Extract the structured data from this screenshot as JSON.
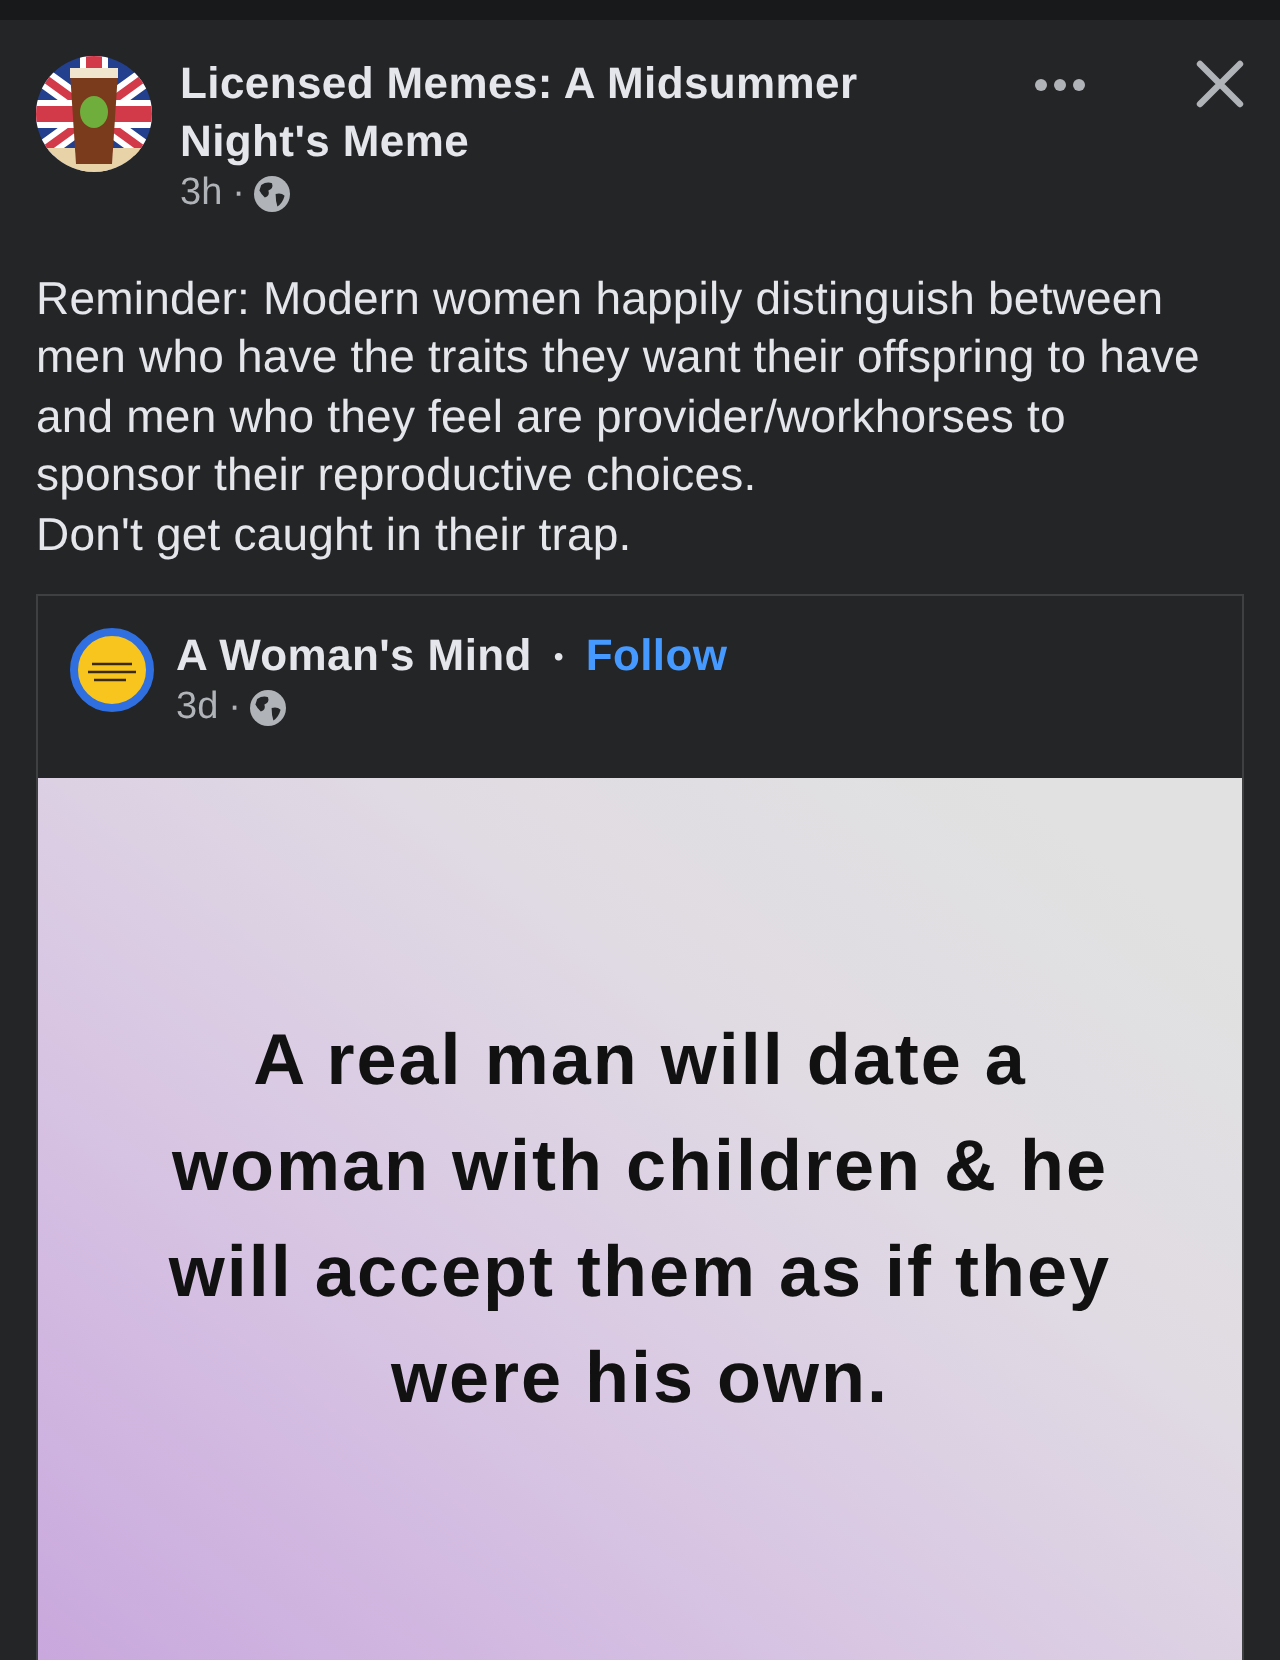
{
  "post": {
    "author": "Licensed Memes: A Midsummer Night's Meme",
    "time": "3h",
    "time_separator": "·",
    "text": [
      "Reminder: Modern women happily distinguish between men who have the traits they want their offspring to have and men who they feel are provider/workhorses to sponsor their reproductive choices.",
      "Don't get caught in their trap."
    ]
  },
  "shared_post": {
    "author": "A Woman's Mind",
    "author_separator": "•",
    "follow_label": "Follow",
    "time": "3d",
    "time_separator": "·",
    "image_text": "A real man will date a woman with children & he will accept them as if they were his own."
  }
}
